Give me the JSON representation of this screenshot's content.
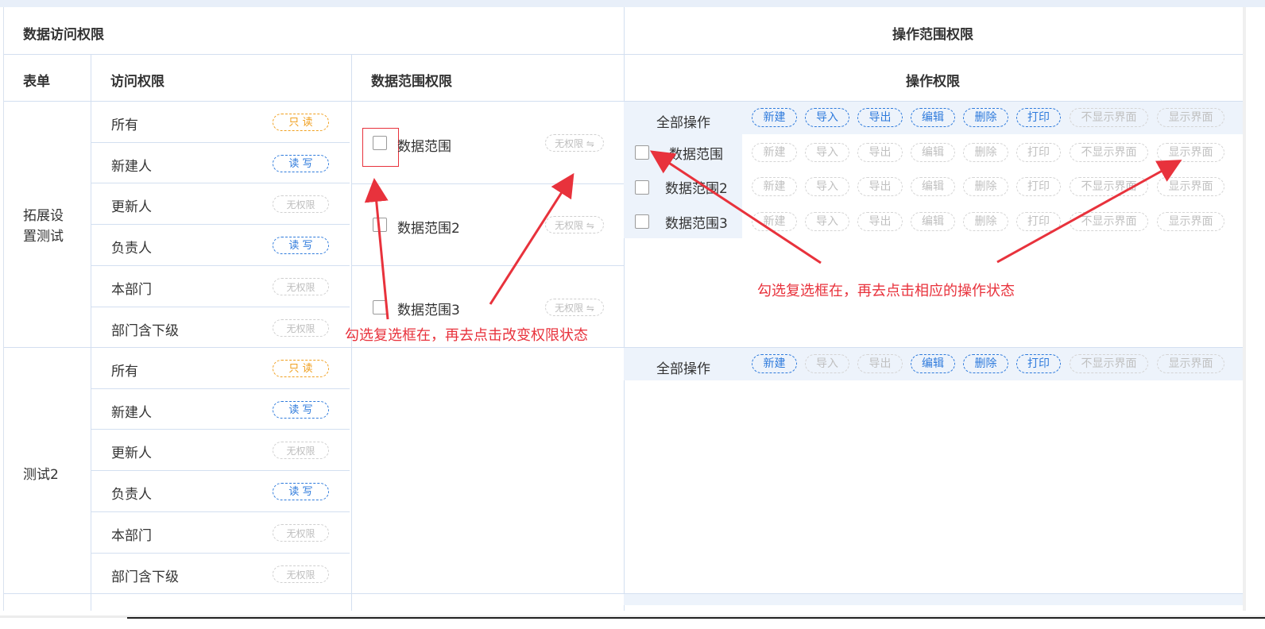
{
  "header": {
    "left_title": "数据访问权限",
    "right_title": "操作范围权限",
    "col_form": "表单",
    "col_access": "访问权限",
    "col_range": "数据范围权限",
    "col_ops": "操作权限"
  },
  "groups": [
    {
      "name": "拓展设置测试",
      "rows": [
        {
          "label": "所有",
          "tag": "只 读",
          "tag_type": "ro"
        },
        {
          "label": "新建人",
          "tag": "读 写",
          "tag_type": "rw"
        },
        {
          "label": "更新人",
          "tag": "无权限",
          "tag_type": "none"
        },
        {
          "label": "负责人",
          "tag": "读 写",
          "tag_type": "rw"
        },
        {
          "label": "本部门",
          "tag": "无权限",
          "tag_type": "none"
        },
        {
          "label": "部门含下级",
          "tag": "无权限",
          "tag_type": "none"
        }
      ],
      "ranges": [
        {
          "label": "数据范围",
          "tag": "无权限 ⇋"
        },
        {
          "label": "数据范围2",
          "tag": "无权限 ⇋"
        },
        {
          "label": "数据范围3",
          "tag": "无权限 ⇋"
        }
      ],
      "op_rows": [
        {
          "label": "全部操作",
          "ops": [
            [
              "新建",
              "on"
            ],
            [
              "导入",
              "on"
            ],
            [
              "导出",
              "on"
            ],
            [
              "编辑",
              "on"
            ],
            [
              "删除",
              "on"
            ],
            [
              "打印",
              "on"
            ],
            [
              "不显示界面",
              "off"
            ],
            [
              "显示界面",
              "off"
            ]
          ]
        },
        {
          "label": "数据范围",
          "ops": [
            [
              "新建",
              "off"
            ],
            [
              "导入",
              "off"
            ],
            [
              "导出",
              "off"
            ],
            [
              "编辑",
              "off"
            ],
            [
              "删除",
              "off"
            ],
            [
              "打印",
              "off"
            ],
            [
              "不显示界面",
              "off"
            ],
            [
              "显示界面",
              "off"
            ]
          ]
        },
        {
          "label": "数据范围2",
          "ops": [
            [
              "新建",
              "off"
            ],
            [
              "导入",
              "off"
            ],
            [
              "导出",
              "off"
            ],
            [
              "编辑",
              "off"
            ],
            [
              "删除",
              "off"
            ],
            [
              "打印",
              "off"
            ],
            [
              "不显示界面",
              "off"
            ],
            [
              "显示界面",
              "off"
            ]
          ]
        },
        {
          "label": "数据范围3",
          "ops": [
            [
              "新建",
              "off"
            ],
            [
              "导入",
              "off"
            ],
            [
              "导出",
              "off"
            ],
            [
              "编辑",
              "off"
            ],
            [
              "删除",
              "off"
            ],
            [
              "打印",
              "off"
            ],
            [
              "不显示界面",
              "off"
            ],
            [
              "显示界面",
              "off"
            ]
          ]
        }
      ]
    },
    {
      "name": "测试2",
      "rows": [
        {
          "label": "所有",
          "tag": "只 读",
          "tag_type": "ro"
        },
        {
          "label": "新建人",
          "tag": "读 写",
          "tag_type": "rw"
        },
        {
          "label": "更新人",
          "tag": "无权限",
          "tag_type": "none"
        },
        {
          "label": "负责人",
          "tag": "读 写",
          "tag_type": "rw"
        },
        {
          "label": "本部门",
          "tag": "无权限",
          "tag_type": "none"
        },
        {
          "label": "部门含下级",
          "tag": "无权限",
          "tag_type": "none"
        }
      ],
      "op_rows": [
        {
          "label": "全部操作",
          "ops": [
            [
              "新建",
              "on"
            ],
            [
              "导入",
              "off"
            ],
            [
              "导出",
              "off"
            ],
            [
              "编辑",
              "on"
            ],
            [
              "删除",
              "on"
            ],
            [
              "打印",
              "on"
            ],
            [
              "不显示界面",
              "off"
            ],
            [
              "显示界面",
              "off"
            ]
          ]
        }
      ]
    }
  ],
  "annotations": {
    "left": "勾选复选框在，再去点击改变权限状态",
    "right": "勾选复选框在，再去点击相应的操作状态"
  },
  "colors": {
    "accent": "#2f7bdc",
    "readonly": "#f0a020",
    "annotation": "#e8323c"
  }
}
